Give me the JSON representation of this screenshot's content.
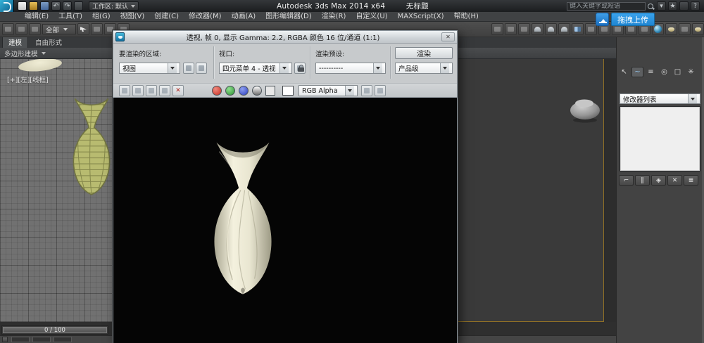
{
  "app": {
    "title_main": "Autodesk 3ds Max 2014 x64",
    "title_doc": "无标题",
    "workspace": "工作区: 默认",
    "search_placeholder": "键入关键字或短语",
    "upload_label": "拖拽上传"
  },
  "colors": {
    "accent_blue": "#2e9be6",
    "render_canvas_bg": "#050505",
    "vase_render": "#efecd8",
    "vase_viewport_wireframe": "#b8bb70",
    "active_viewport_border": "#8f7026"
  },
  "icons": {
    "undo": "↶",
    "redo": "↷",
    "close": "✕",
    "delete": "✕",
    "star": "★",
    "help": "?",
    "caret": "▾"
  },
  "menubar": {
    "items": [
      "编辑(E)",
      "工具(T)",
      "组(G)",
      "视图(V)",
      "创建(C)",
      "修改器(M)",
      "动画(A)",
      "图形编辑器(D)",
      "渲染(R)",
      "自定义(U)",
      "MAXScript(X)",
      "帮助(H)"
    ]
  },
  "toolbar": {
    "selection_filter_value": "全部"
  },
  "ribbon": {
    "tabs": [
      "建模",
      "自由形式"
    ],
    "panel_label": "多边形建模"
  },
  "viewport": {
    "left_label": "[+][左][线框]"
  },
  "render_window": {
    "title": "透视, 帧 0, 显示 Gamma: 2.2, RGBA 颜色 16 位/通道 (1:1)",
    "area_label": "要渲染的区域:",
    "area_value": "视图",
    "viewport_label": "视口:",
    "viewport_value": "四元菜单 4 - 透视",
    "preset_label": "渲染预设:",
    "preset_value": "----------",
    "quality_value": "产品级",
    "render_button_label": "渲染",
    "channel_display_value": "RGB Alpha"
  },
  "command_panel": {
    "tab_glyphs": [
      "↖",
      "~",
      "≡",
      "◎",
      "□",
      "✳"
    ],
    "modifier_list_value": "修改器列表",
    "stack_buttons": [
      "⌐",
      "‖",
      "◈",
      "✕",
      "≣"
    ]
  },
  "timeline": {
    "frame_display": "0 / 100"
  }
}
